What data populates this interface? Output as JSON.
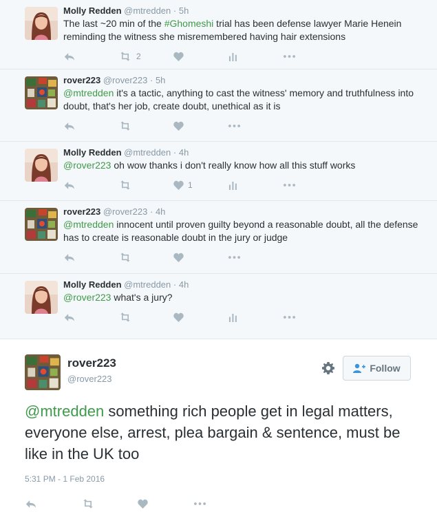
{
  "thread": [
    {
      "name": "Molly Redden",
      "handle": "@mtredden",
      "time": "5h",
      "text_before": "The last ~20 min of the ",
      "hashtag": "#Ghomeshi",
      "text_after": " trial has been defense lawyer Marie Henein reminding the witness she misremembered having hair extensions",
      "retweets": "2",
      "likes": ""
    },
    {
      "name": "rover223",
      "handle": "@rover223",
      "time": "5h",
      "mention": "@mtredden",
      "text": " it's a tactic, anything to cast the witness' memory and truthfulness into doubt, that's her job, create doubt, unethical as it is"
    },
    {
      "name": "Molly Redden",
      "handle": "@mtredden",
      "time": "4h",
      "mention": "@rover223",
      "text": " oh wow thanks i don't really know how all this stuff works",
      "likes": "1"
    },
    {
      "name": "rover223",
      "handle": "@rover223",
      "time": "4h",
      "mention": "@mtredden",
      "text": " innocent until proven guilty beyond a reasonable doubt, all the defense has to create is reasonable doubt in the jury or judge"
    },
    {
      "name": "Molly Redden",
      "handle": "@mtredden",
      "time": "4h",
      "mention": "@rover223",
      "text": " what's a jury?"
    }
  ],
  "main": {
    "name": "rover223",
    "handle": "@rover223",
    "mention": "@mtredden",
    "text": " something rich people get in legal matters, everyone else, arrest, plea bargain & sentence, must be like in the UK too",
    "timestamp": "5:31 PM - 1 Feb 2016",
    "follow_label": "Follow"
  },
  "colors": {
    "accent_green": "#3f9a4a",
    "gray_text": "#8899a6",
    "icon_gray": "#aab8c2"
  }
}
